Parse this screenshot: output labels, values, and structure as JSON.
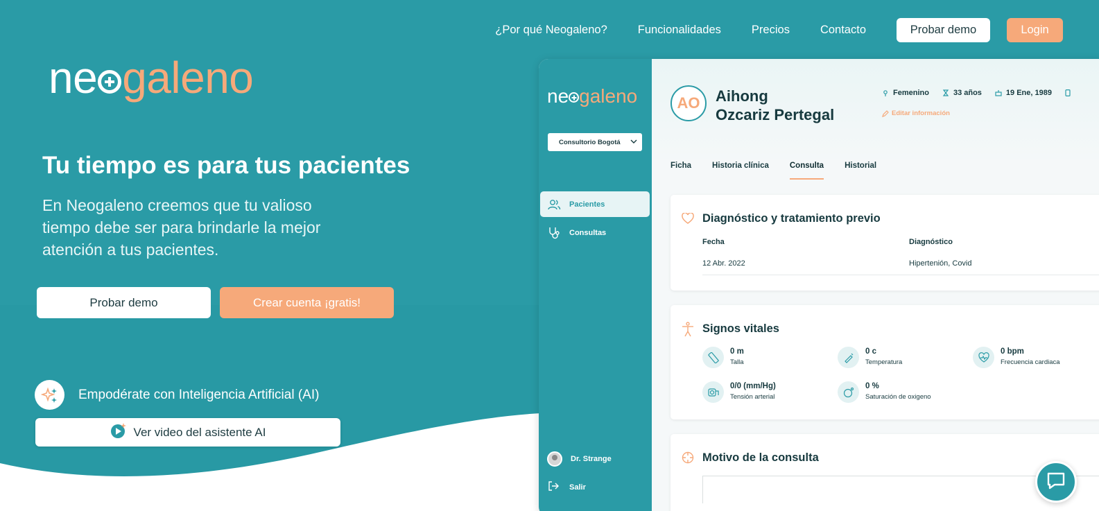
{
  "nav": {
    "links": [
      "¿Por qué Neogaleno?",
      "Funcionalidades",
      "Precios",
      "Contacto"
    ],
    "demo_label": "Probar demo",
    "login_label": "Login"
  },
  "logo": {
    "part1": "ne",
    "part2": "galeno"
  },
  "hero": {
    "title": "Tu tiempo es para tus pacientes",
    "subtitle": "En Neogaleno creemos que tu valioso tiempo debe ser para brindarle la mejor atención a tus pacientes.",
    "demo_button": "Probar demo",
    "signup_button": "Crear cuenta ¡gratis!"
  },
  "ai": {
    "text": "Empodérate con Inteligencia Artificial (AI)",
    "video_button": "Ver video del asistente AI"
  },
  "app": {
    "sidebar": {
      "clinic_select": "Consultorio Bogotá",
      "items": [
        {
          "label": "Pacientes",
          "icon": "users-icon"
        },
        {
          "label": "Consultas",
          "icon": "stethoscope-icon"
        }
      ],
      "user": "Dr. Strange",
      "exit": "Salir"
    },
    "patient": {
      "initials": "AO",
      "first_name": "Aihong",
      "last_name": "Ozcariz Pertegal",
      "gender": "Femenino",
      "age": "33 años",
      "birthdate": "19 Ene, 1989",
      "edit_label": "Editar información"
    },
    "tabs": [
      "Ficha",
      "Historia clínica",
      "Consulta",
      "Historial"
    ],
    "active_tab": "Consulta",
    "diagnosis_card": {
      "title": "Diagnóstico y tratamiento previo",
      "headers": [
        "Fecha",
        "Diagnóstico"
      ],
      "rows": [
        [
          "12 Abr. 2022",
          "Hipertenión, Covid"
        ]
      ]
    },
    "vitals_card": {
      "title": "Signos vitales",
      "items": [
        {
          "value": "0 m",
          "label": "Talla",
          "icon": "ruler-icon"
        },
        {
          "value": "0 c",
          "label": "Temperatura",
          "icon": "thermometer-icon"
        },
        {
          "value": "0 bpm",
          "label": "Frecuencia cardiaca",
          "icon": "heart-rate-icon"
        },
        {
          "value": "0/0 (mm/Hg)",
          "label": "Tensión arterial",
          "icon": "blood-pressure-icon"
        },
        {
          "value": "0 %",
          "label": "Saturación de oxigeno",
          "icon": "oxygen-icon"
        }
      ]
    },
    "reason_card": {
      "title": "Motivo de la consulta"
    }
  },
  "colors": {
    "teal": "#2A9BA6",
    "orange": "#F6A97A",
    "dark_text": "#173a3f",
    "white": "#ffffff"
  }
}
